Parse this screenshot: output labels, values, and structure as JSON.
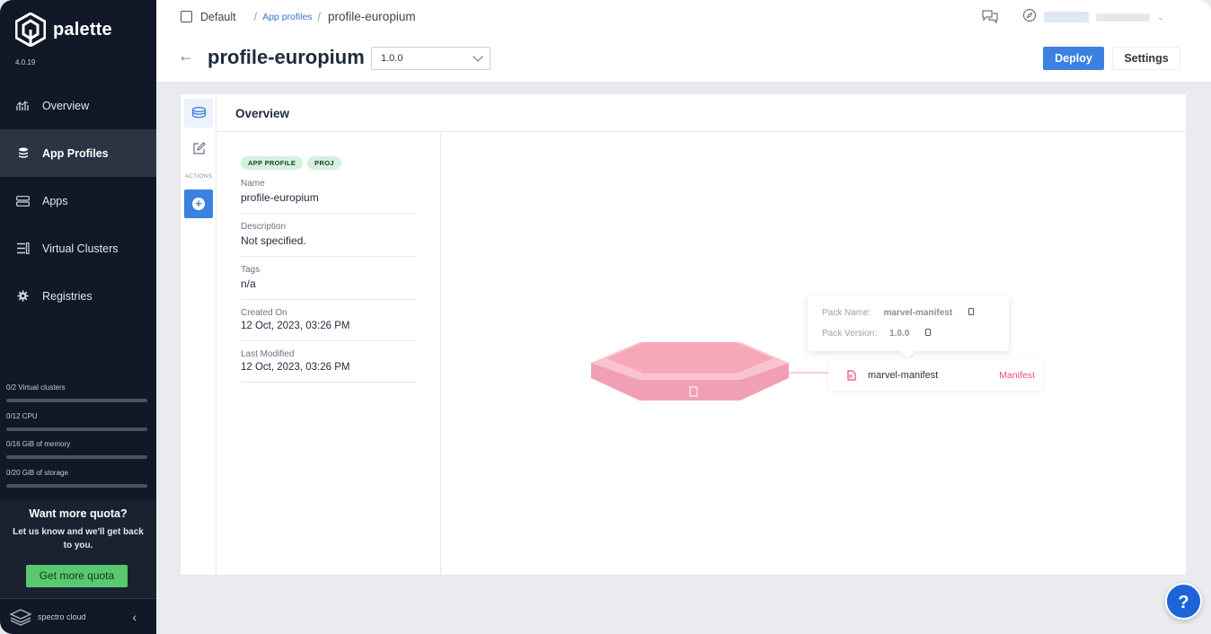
{
  "app": {
    "name": "palette",
    "version": "4.0.19"
  },
  "sidebar": {
    "items": [
      {
        "label": "Overview",
        "icon": "chart-icon",
        "active": false
      },
      {
        "label": "App Profiles",
        "icon": "stack-icon",
        "active": true
      },
      {
        "label": "Apps",
        "icon": "server-icon",
        "active": false
      },
      {
        "label": "Virtual Clusters",
        "icon": "clusters-icon",
        "active": false
      },
      {
        "label": "Registries",
        "icon": "gear-icon",
        "active": false
      }
    ],
    "quotas": [
      {
        "label": "0/2 Virtual clusters",
        "fraction": 0
      },
      {
        "label": "0/12 CPU",
        "fraction": 0
      },
      {
        "label": "0/16 GiB of memory",
        "fraction": 0
      },
      {
        "label": "0/20 GiB of storage",
        "fraction": 0
      }
    ],
    "more_quota": {
      "title": "Want more quota?",
      "subtitle": "Let us know and we'll get back to you.",
      "button": "Get more quota"
    },
    "footer": "spectro cloud"
  },
  "breadcrumb": {
    "project": "Default",
    "section": "App profiles",
    "current": "profile-europium"
  },
  "header": {
    "title": "profile-europium",
    "version_selected": "1.0.0",
    "deploy_label": "Deploy",
    "settings_label": "Settings"
  },
  "rail": {
    "actions_label": "ACTIONS"
  },
  "overview": {
    "title": "Overview",
    "tags": [
      "APP PROFILE",
      "PROJ"
    ],
    "fields": [
      {
        "label": "Name",
        "value": "profile-europium"
      },
      {
        "label": "Description",
        "value": "Not specified."
      },
      {
        "label": "Tags",
        "value": "n/a"
      },
      {
        "label": "Created On",
        "value": "12 Oct, 2023, 03:26 PM"
      },
      {
        "label": "Last Modified",
        "value": "12 Oct, 2023, 03:26 PM"
      }
    ]
  },
  "canvas": {
    "tooltip": {
      "pack_name_label": "Pack Name:",
      "pack_name": "marvel-manifest",
      "pack_version_label": "Pack Version:",
      "pack_version": "1.0.0"
    },
    "pack": {
      "name": "marvel-manifest",
      "annotation": "Manifest"
    },
    "layer_color": "#f7a8b8",
    "accent": "#ef4b7c"
  },
  "help": "?"
}
